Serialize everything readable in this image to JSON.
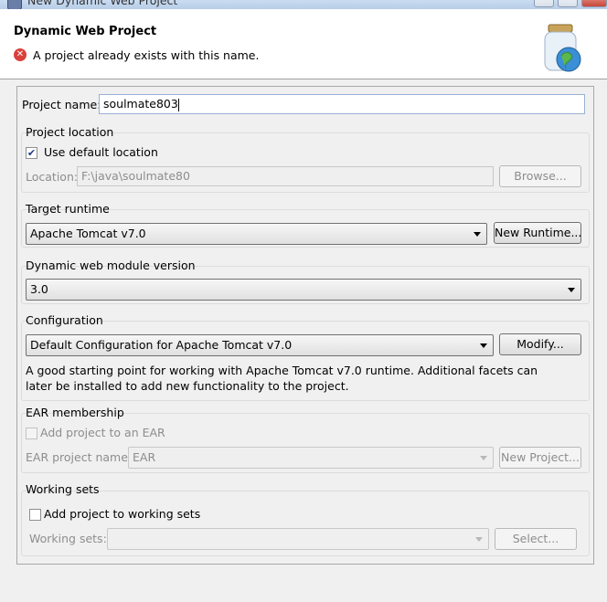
{
  "window": {
    "title": "New Dynamic Web Project"
  },
  "banner": {
    "heading": "Dynamic Web Project",
    "message": "A project already exists with this name."
  },
  "project_name": {
    "label": "Project name:",
    "value": "soulmate803"
  },
  "project_location": {
    "title": "Project location",
    "use_default_label": "Use default location",
    "use_default_checked": true,
    "location_label": "Location:",
    "location_value": "F:\\java\\soulmate80",
    "browse_label": "Browse..."
  },
  "target_runtime": {
    "title": "Target runtime",
    "selected": "Apache Tomcat v7.0",
    "new_runtime_label": "New Runtime..."
  },
  "module_version": {
    "title": "Dynamic web module version",
    "selected": "3.0"
  },
  "configuration": {
    "title": "Configuration",
    "selected": "Default Configuration for Apache Tomcat v7.0",
    "modify_label": "Modify...",
    "description": "A good starting point for working with Apache Tomcat v7.0 runtime. Additional facets can later be installed to add new functionality to the project."
  },
  "ear": {
    "title": "EAR membership",
    "add_label": "Add project to an EAR",
    "add_checked": false,
    "project_name_label": "EAR project name:",
    "project_name_value": "EAR",
    "new_project_label": "New Project..."
  },
  "working_sets": {
    "title": "Working sets",
    "add_label": "Add project to working sets",
    "add_checked": false,
    "sets_label": "Working sets:",
    "sets_value": "",
    "select_label": "Select..."
  },
  "icons": {
    "error": "error-icon",
    "wizard": "web-project-jar-globe-icon"
  }
}
